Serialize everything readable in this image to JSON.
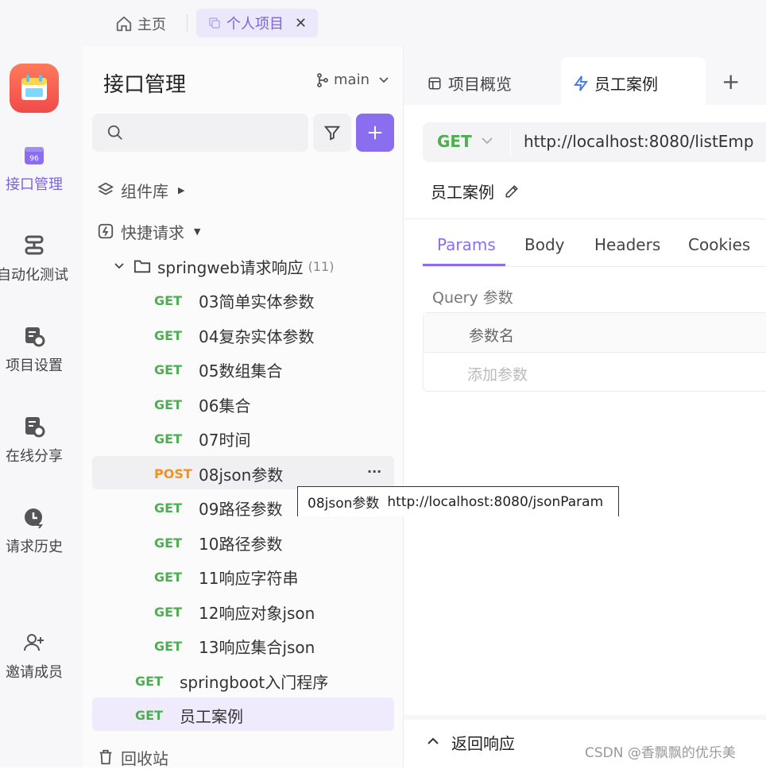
{
  "top_tabs": [
    {
      "label": "主页"
    },
    {
      "label": "个人项目"
    }
  ],
  "rail": [
    {
      "label": "接口管理"
    },
    {
      "label": "自动化测试"
    },
    {
      "label": "项目设置"
    },
    {
      "label": "在线分享"
    },
    {
      "label": "请求历史"
    },
    {
      "label": "邀请成员"
    }
  ],
  "sidebar": {
    "title": "接口管理",
    "branch": "main",
    "search_placeholder": "",
    "component_lib": "组件库",
    "quick_request": "快捷请求",
    "folder": {
      "name": "springweb请求响应",
      "count": "(11)"
    },
    "items": [
      {
        "method": "GET",
        "name": "03简单实体参数"
      },
      {
        "method": "GET",
        "name": "04复杂实体参数"
      },
      {
        "method": "GET",
        "name": "05数组集合"
      },
      {
        "method": "GET",
        "name": "06集合"
      },
      {
        "method": "GET",
        "name": "07时间"
      },
      {
        "method": "POST",
        "name": "08json参数"
      },
      {
        "method": "GET",
        "name": "09路径参数"
      },
      {
        "method": "GET",
        "name": "10路径参数"
      },
      {
        "method": "GET",
        "name": "11响应字符串"
      },
      {
        "method": "GET",
        "name": "12响应对象json"
      },
      {
        "method": "GET",
        "name": "13响应集合json"
      }
    ],
    "root_items": [
      {
        "method": "GET",
        "name": "springboot入门程序"
      },
      {
        "method": "GET",
        "name": "员工案例"
      }
    ],
    "recycle": "回收站",
    "more": "···"
  },
  "tooltip": {
    "name": "08json参数",
    "url": "http://localhost:8080/jsonParam"
  },
  "main": {
    "tabs": [
      {
        "label": "项目概览"
      },
      {
        "label": "员工案例"
      }
    ],
    "method": "GET",
    "url": "http://localhost:8080/listEmp",
    "request_name": "员工案例",
    "param_tabs": [
      "Params",
      "Body",
      "Headers",
      "Cookies"
    ],
    "query_title": "Query 参数",
    "col_name": "参数名",
    "add_param": "添加参数",
    "response_label": "返回响应",
    "watermark": "CSDN @香飘飘的优乐美"
  },
  "colors": {
    "accent": "#8b6ef0",
    "get": "#4caf50",
    "post": "#f2911b"
  }
}
